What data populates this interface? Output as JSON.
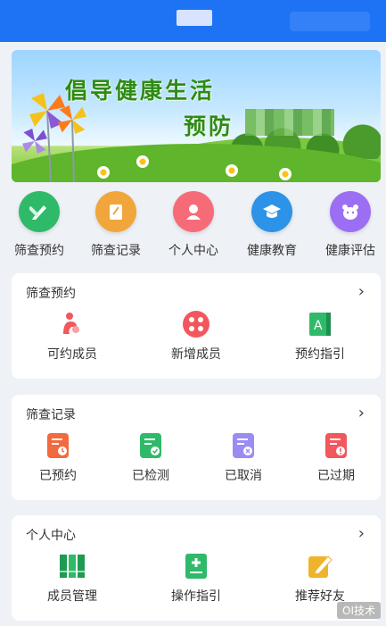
{
  "header": {
    "title": ""
  },
  "banner": {
    "line1": "倡导健康生活",
    "line2": "预防"
  },
  "quick_nav": [
    {
      "label": "筛查预约",
      "color": "#2fba6a",
      "icon": "pencil-ruler-icon"
    },
    {
      "label": "筛查记录",
      "color": "#f0a63b",
      "icon": "notepad-icon"
    },
    {
      "label": "个人中心",
      "color": "#f66b78",
      "icon": "person-icon"
    },
    {
      "label": "健康教育",
      "color": "#2d93e8",
      "icon": "graduation-cap-icon"
    },
    {
      "label": "健康评估",
      "color": "#9b6ef3",
      "icon": "bear-icon"
    }
  ],
  "cards": {
    "appointment": {
      "title": "筛查预约",
      "items": [
        {
          "label": "可约成员"
        },
        {
          "label": "新增成员"
        },
        {
          "label": "预约指引"
        }
      ]
    },
    "records": {
      "title": "筛查记录",
      "items": [
        {
          "label": "已预约"
        },
        {
          "label": "已检测"
        },
        {
          "label": "已取消"
        },
        {
          "label": "已过期"
        }
      ]
    },
    "personal": {
      "title": "个人中心",
      "items": [
        {
          "label": "成员管理"
        },
        {
          "label": "操作指引"
        },
        {
          "label": "推荐好友"
        }
      ]
    }
  },
  "arrow": "›",
  "watermark": "OI技术"
}
